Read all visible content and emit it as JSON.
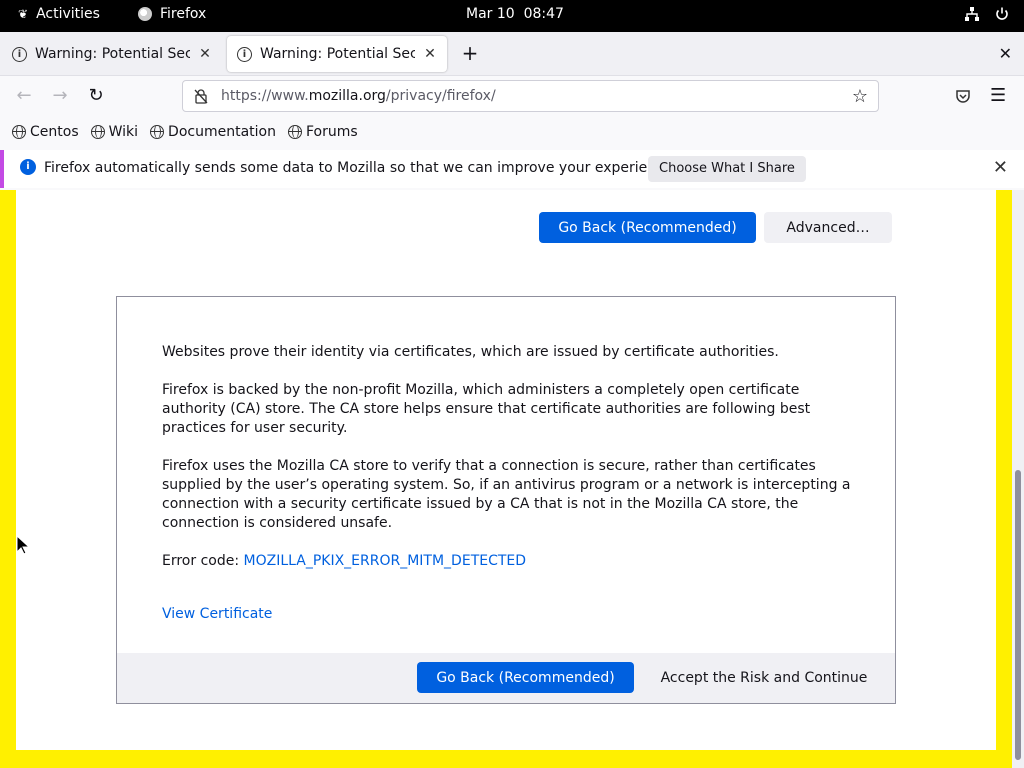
{
  "topbar": {
    "activities": "Activities",
    "app_name": "Firefox",
    "clock": "Mar 10  08:47"
  },
  "tabs": [
    {
      "title": "Warning: Potential Security Risk Ahead",
      "active": false
    },
    {
      "title": "Warning: Potential Security Risk Ahead",
      "active": true
    }
  ],
  "navbar": {
    "url_prefix": "https://www.",
    "url_host": "mozilla.org",
    "url_path": "/privacy/firefox/"
  },
  "bookmarks": [
    {
      "label": "Centos"
    },
    {
      "label": "Wiki"
    },
    {
      "label": "Documentation"
    },
    {
      "label": "Forums"
    }
  ],
  "notification": {
    "message": "Firefox automatically sends some data to Mozilla so that we can improve your experience.",
    "button": "Choose What I Share"
  },
  "page": {
    "top_go_back": "Go Back (Recommended)",
    "top_advanced": "Advanced…",
    "paragraphs": [
      "Websites prove their identity via certificates, which are issued by certificate authorities.",
      "Firefox is backed by the non-profit Mozilla, which administers a completely open certificate authority (CA) store. The CA store helps ensure that certificate authorities are following best practices for user security.",
      "Firefox uses the Mozilla CA store to verify that a connection is secure, rather than certificates supplied by the user’s operating system. So, if an antivirus program or a network is intercepting a connection with a security certificate issued by a CA that is not in the Mozilla CA store, the connection is considered unsafe."
    ],
    "error_label": "Error code: ",
    "error_code": "MOZILLA_PKIX_ERROR_MITM_DETECTED",
    "view_certificate": "View Certificate",
    "bottom_go_back": "Go Back (Recommended)",
    "accept_risk": "Accept the Risk and Continue"
  },
  "colors": {
    "accent": "#0060df",
    "page_border": "#fff000",
    "notification_stripe": "#c34ae4"
  }
}
